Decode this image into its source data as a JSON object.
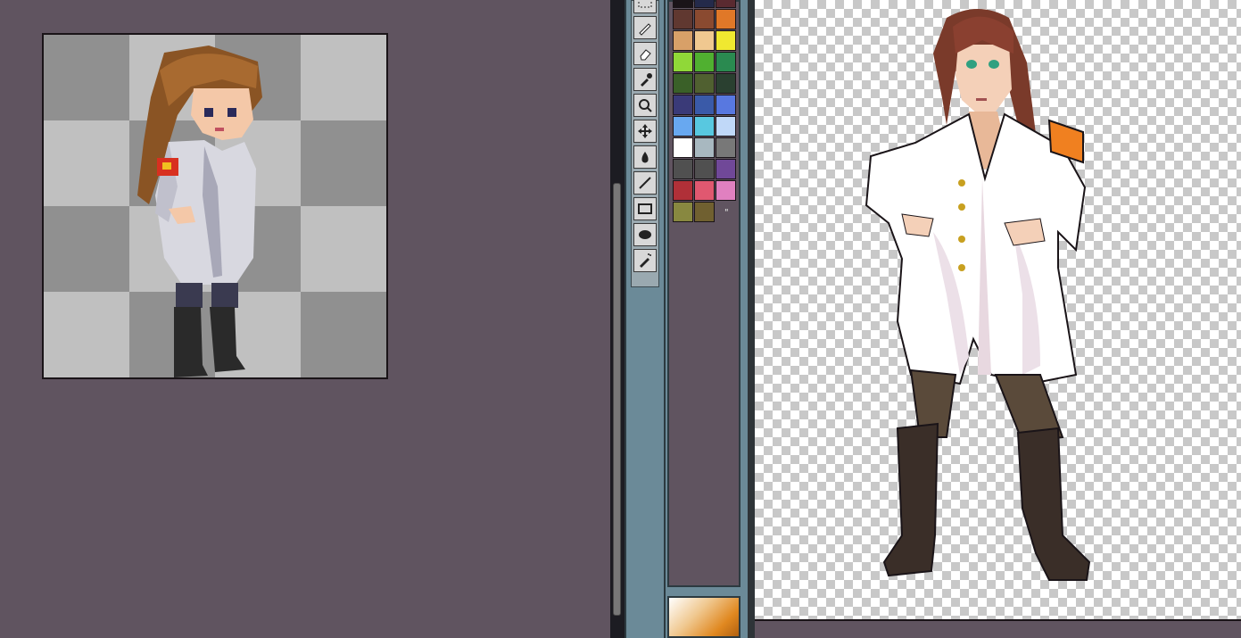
{
  "app": {
    "workspace_color": "#605460",
    "panel_color": "#6b8a98"
  },
  "tools": [
    {
      "name": "marquee-select-icon",
      "label": ""
    },
    {
      "name": "pencil-icon",
      "label": ""
    },
    {
      "name": "eraser-icon",
      "label": ""
    },
    {
      "name": "eyedropper-icon",
      "label": ""
    },
    {
      "name": "zoom-icon",
      "label": ""
    },
    {
      "name": "move-icon",
      "label": ""
    },
    {
      "name": "fill-bucket-icon",
      "label": ""
    },
    {
      "name": "line-icon",
      "label": ""
    },
    {
      "name": "rectangle-icon",
      "label": ""
    },
    {
      "name": "ellipse-icon",
      "label": ""
    },
    {
      "name": "spray-icon",
      "label": ""
    }
  ],
  "palette": {
    "marker": "\"",
    "colors": [
      "#1a1418",
      "#242a4a",
      "#5a2a30",
      "#603830",
      "#8a4a30",
      "#e07828",
      "#d8a068",
      "#f0c890",
      "#f0e830",
      "#90d838",
      "#50b030",
      "#2a8a50",
      "#3a6028",
      "#506030",
      "#2a4030",
      "#3a3a78",
      "#3a5aa8",
      "#5878e0",
      "#68a8f0",
      "#58c8e0",
      "#c0d8f8",
      "#ffffff",
      "#a8b8c0",
      "#787878",
      "#505050",
      "#505050",
      "#704898",
      "#b03038",
      "#e05870",
      "#e080c0",
      "#888840",
      "#706030"
    ]
  },
  "canvas": {
    "checker_light": "#c0c0c0",
    "checker_dark": "#909090"
  }
}
